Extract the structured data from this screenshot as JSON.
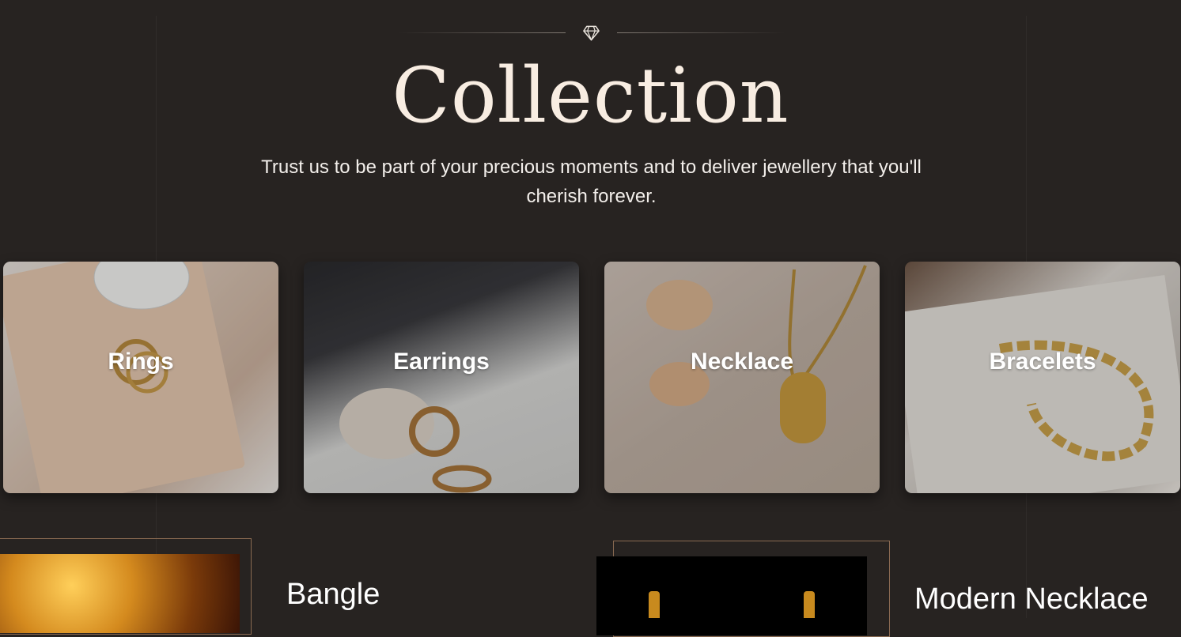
{
  "header": {
    "title": "Collection",
    "subtitle": "Trust us to be part of your precious moments and to deliver jewellery that you'll cherish forever.",
    "ornament_icon": "diamond-icon"
  },
  "categories": [
    {
      "label": "Rings"
    },
    {
      "label": "Earrings"
    },
    {
      "label": "Necklace"
    },
    {
      "label": "Bracelets"
    }
  ],
  "products": [
    {
      "name": "Bangle"
    },
    {
      "name": "Modern Necklace"
    }
  ],
  "colors": {
    "background": "#272321",
    "title": "#f8ede2",
    "accent_border": "#8a6a52"
  }
}
